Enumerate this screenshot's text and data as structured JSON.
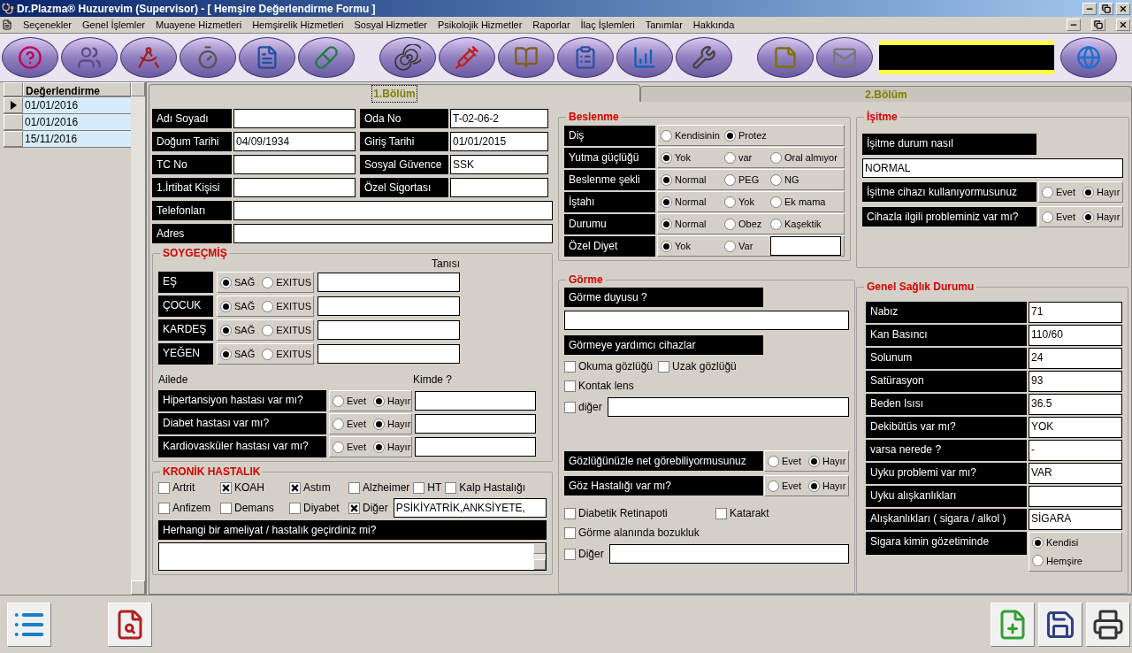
{
  "window": {
    "title": "Dr.Plazma® Huzurevim (Supervisor) - [ Hemşire Değerlendirme Formu ]"
  },
  "menu": [
    "Seçenekler",
    "Genel İşlemler",
    "Muayene Hizmetleri",
    "Hemşirelik Hizmetleri",
    "Sosyal Hizmetler",
    "Psikolojik Hizmetler",
    "Raporlar",
    "İlaç İşlemleri",
    "Tanımlar",
    "Hakkında"
  ],
  "records": {
    "column": "Değerlendirme",
    "rows": [
      {
        "date": "01/01/2016",
        "selected": true
      },
      {
        "date": "01/01/2016",
        "selected": false
      },
      {
        "date": "15/11/2016",
        "selected": false
      }
    ]
  },
  "tabs": [
    {
      "label": "1.Bölüm",
      "selected": true
    },
    {
      "label": "2.Bölüm",
      "selected": false
    }
  ],
  "identity": {
    "pairs": [
      [
        {
          "label": "Adı Soyadı"
        },
        {
          "label": "Oda No",
          "value": "T-02-06-2"
        }
      ],
      [
        {
          "label": "Doğum Tarihi",
          "value": "04/09/1934"
        },
        {
          "label": "Giriş Tarihi",
          "value": "01/01/2015"
        }
      ],
      [
        {
          "label": "TC No"
        },
        {
          "label": "Sosyal Güvence",
          "value": "SSK"
        }
      ],
      [
        {
          "label": "1.İrtibat Kişisi"
        },
        {
          "label": "Özel Sigortası"
        }
      ]
    ],
    "wide": [
      {
        "label": "Telefonları"
      },
      {
        "label": "Adres"
      }
    ]
  },
  "soygecmis": {
    "title": "SOYGEÇMİŞ",
    "diagnosis_header": "Tanısı",
    "relatives": [
      {
        "label": "EŞ",
        "options": [
          {
            "label": "SAĞ",
            "selected": true
          },
          {
            "label": "EXITUS",
            "selected": false
          }
        ]
      },
      {
        "label": "ÇOCUK",
        "options": [
          {
            "label": "SAĞ",
            "selected": true
          },
          {
            "label": "EXITUS",
            "selected": false
          }
        ]
      },
      {
        "label": "KARDEŞ",
        "options": [
          {
            "label": "SAĞ",
            "selected": true
          },
          {
            "label": "EXITUS",
            "selected": false
          }
        ]
      },
      {
        "label": "YEĞEN",
        "options": [
          {
            "label": "SAĞ",
            "selected": true
          },
          {
            "label": "EXITUS",
            "selected": false
          }
        ]
      }
    ],
    "family_header": "Ailede",
    "who_header": "Kimde ?",
    "family": [
      {
        "label": "Hipertansiyon hastası var mı?",
        "options": [
          {
            "label": "Evet",
            "selected": false
          },
          {
            "label": "Hayır",
            "selected": true
          }
        ]
      },
      {
        "label": "Diabet hastası var mı?",
        "options": [
          {
            "label": "Evet",
            "selected": false
          },
          {
            "label": "Hayır",
            "selected": true
          }
        ]
      },
      {
        "label": "Kardiovasküler hastası var mı?",
        "options": [
          {
            "label": "Evet",
            "selected": false
          },
          {
            "label": "Hayır",
            "selected": true
          }
        ]
      }
    ]
  },
  "kronik": {
    "title": "KRONİK HASTALIK",
    "rows": [
      [
        {
          "label": "Artrit",
          "checked": false
        },
        {
          "label": "KOAH",
          "checked": true
        },
        {
          "label": "Astım",
          "checked": true
        },
        {
          "label": "Alzheimer",
          "checked": false
        },
        {
          "label": "HT",
          "checked": false
        },
        {
          "label": "Kalp Hastalığı",
          "checked": false
        }
      ],
      [
        {
          "label": "Anfizem",
          "checked": false
        },
        {
          "label": "Demans",
          "checked": false
        },
        {
          "label": "Diyabet",
          "checked": false
        },
        {
          "label": "Diğer",
          "checked": true,
          "kind": "field",
          "value": "PSİKİYATRİK,ANKSİYETE,"
        }
      ]
    ],
    "surgery_label": "Herhangi bir ameliyat / hastalık geçirdiniz mi?"
  },
  "beslenme": {
    "title": "Beslenme",
    "rows": [
      {
        "label": "Diş",
        "kind": "radio",
        "options": [
          {
            "label": "Kendisinin",
            "selected": false
          },
          {
            "label": "Protez",
            "selected": true
          }
        ]
      },
      {
        "label": "Yutma güçlüğü",
        "kind": "radio",
        "options": [
          {
            "label": "Yok",
            "selected": true
          },
          {
            "label": "var",
            "selected": false
          },
          {
            "label": "Oral almıyor",
            "selected": false
          }
        ]
      },
      {
        "label": "Beslenme şekli",
        "kind": "radio",
        "options": [
          {
            "label": "Normal",
            "selected": true
          },
          {
            "label": "PEG",
            "selected": false
          },
          {
            "label": "NG",
            "selected": false
          }
        ]
      },
      {
        "label": "İştahı",
        "kind": "radio",
        "options": [
          {
            "label": "Normal",
            "selected": true
          },
          {
            "label": "Yok",
            "selected": false
          },
          {
            "label": "Ek mama",
            "selected": false
          }
        ]
      },
      {
        "label": "Durumu",
        "kind": "radio",
        "options": [
          {
            "label": "Normal",
            "selected": true
          },
          {
            "label": "Obez",
            "selected": false
          },
          {
            "label": "Kaşektik",
            "selected": false
          }
        ]
      },
      {
        "label": "Özel Diyet",
        "kind": "radio_field",
        "options": [
          {
            "label": "Yok",
            "selected": true
          },
          {
            "label": "Var",
            "selected": false
          }
        ]
      }
    ]
  },
  "isitme": {
    "title": "İşitme",
    "state_label": "İşitme durum nasıl",
    "state_value": "NORMAL",
    "questions": [
      {
        "label": "İşitme cihazı kullanıyormusunuz",
        "options": [
          {
            "label": "Evet",
            "selected": false
          },
          {
            "label": "Hayır",
            "selected": true
          }
        ]
      },
      {
        "label": "Cihazla ilgili probleminiz var mı?",
        "options": [
          {
            "label": "Evet",
            "selected": false
          },
          {
            "label": "Hayır",
            "selected": true
          }
        ]
      }
    ]
  },
  "gorme": {
    "title": "Görme",
    "sense_label": "Görme duyusu ?",
    "aids_label": "Görmeye yardımcı cihazlar",
    "aids": [
      [
        {
          "label": "Okuma gözlüğü",
          "checked": false
        },
        {
          "label": "Uzak gözlüğü",
          "checked": false
        }
      ],
      [
        {
          "label": "Kontak lens",
          "checked": false
        }
      ],
      [
        {
          "label": "diğer",
          "checked": false,
          "kind": "field"
        }
      ]
    ],
    "questions": [
      {
        "label": "Gözlüğünüzle net görebiliyormusunuz",
        "options": [
          {
            "label": "Evet",
            "selected": false
          },
          {
            "label": "Hayır",
            "selected": true
          }
        ]
      },
      {
        "label": "Göz Hastalığı var mı?",
        "options": [
          {
            "label": "Evet",
            "selected": false
          },
          {
            "label": "Hayır",
            "selected": true
          }
        ]
      }
    ],
    "diseases": [
      [
        {
          "label": "Diabetik Retinapoti",
          "checked": false
        },
        {
          "label": "Katarakt",
          "checked": false
        }
      ],
      [
        {
          "label": "Görme alanında bozukluk",
          "checked": false
        }
      ],
      [
        {
          "label": "Diğer",
          "checked": false,
          "kind": "field"
        }
      ]
    ]
  },
  "genel": {
    "title": "Genel Sağlık Durumu",
    "rows": [
      {
        "label": "Nabız",
        "value": "71"
      },
      {
        "label": "Kan Basıncı",
        "value": "110/60"
      },
      {
        "label": "Solunum",
        "value": "24"
      },
      {
        "label": "Satürasyon",
        "value": "93"
      },
      {
        "label": "Beden Isısı",
        "value": "36.5"
      },
      {
        "label": "Dekibütüs var mı?",
        "value": "YOK"
      },
      {
        "label": "varsa nerede ?",
        "value": "-"
      },
      {
        "label": "Uyku problemi var mı?",
        "value": "VAR"
      },
      {
        "label": "Uyku alışkanlıkları"
      },
      {
        "label": "Alışkanlıkları ( sigara / alkol )",
        "value": "SİGARA"
      }
    ],
    "smoking": {
      "label": "Sigara kimin gözetiminde",
      "options": [
        {
          "label": "Kendisi",
          "selected": true
        },
        {
          "label": "Hemşire",
          "selected": false
        }
      ]
    }
  }
}
